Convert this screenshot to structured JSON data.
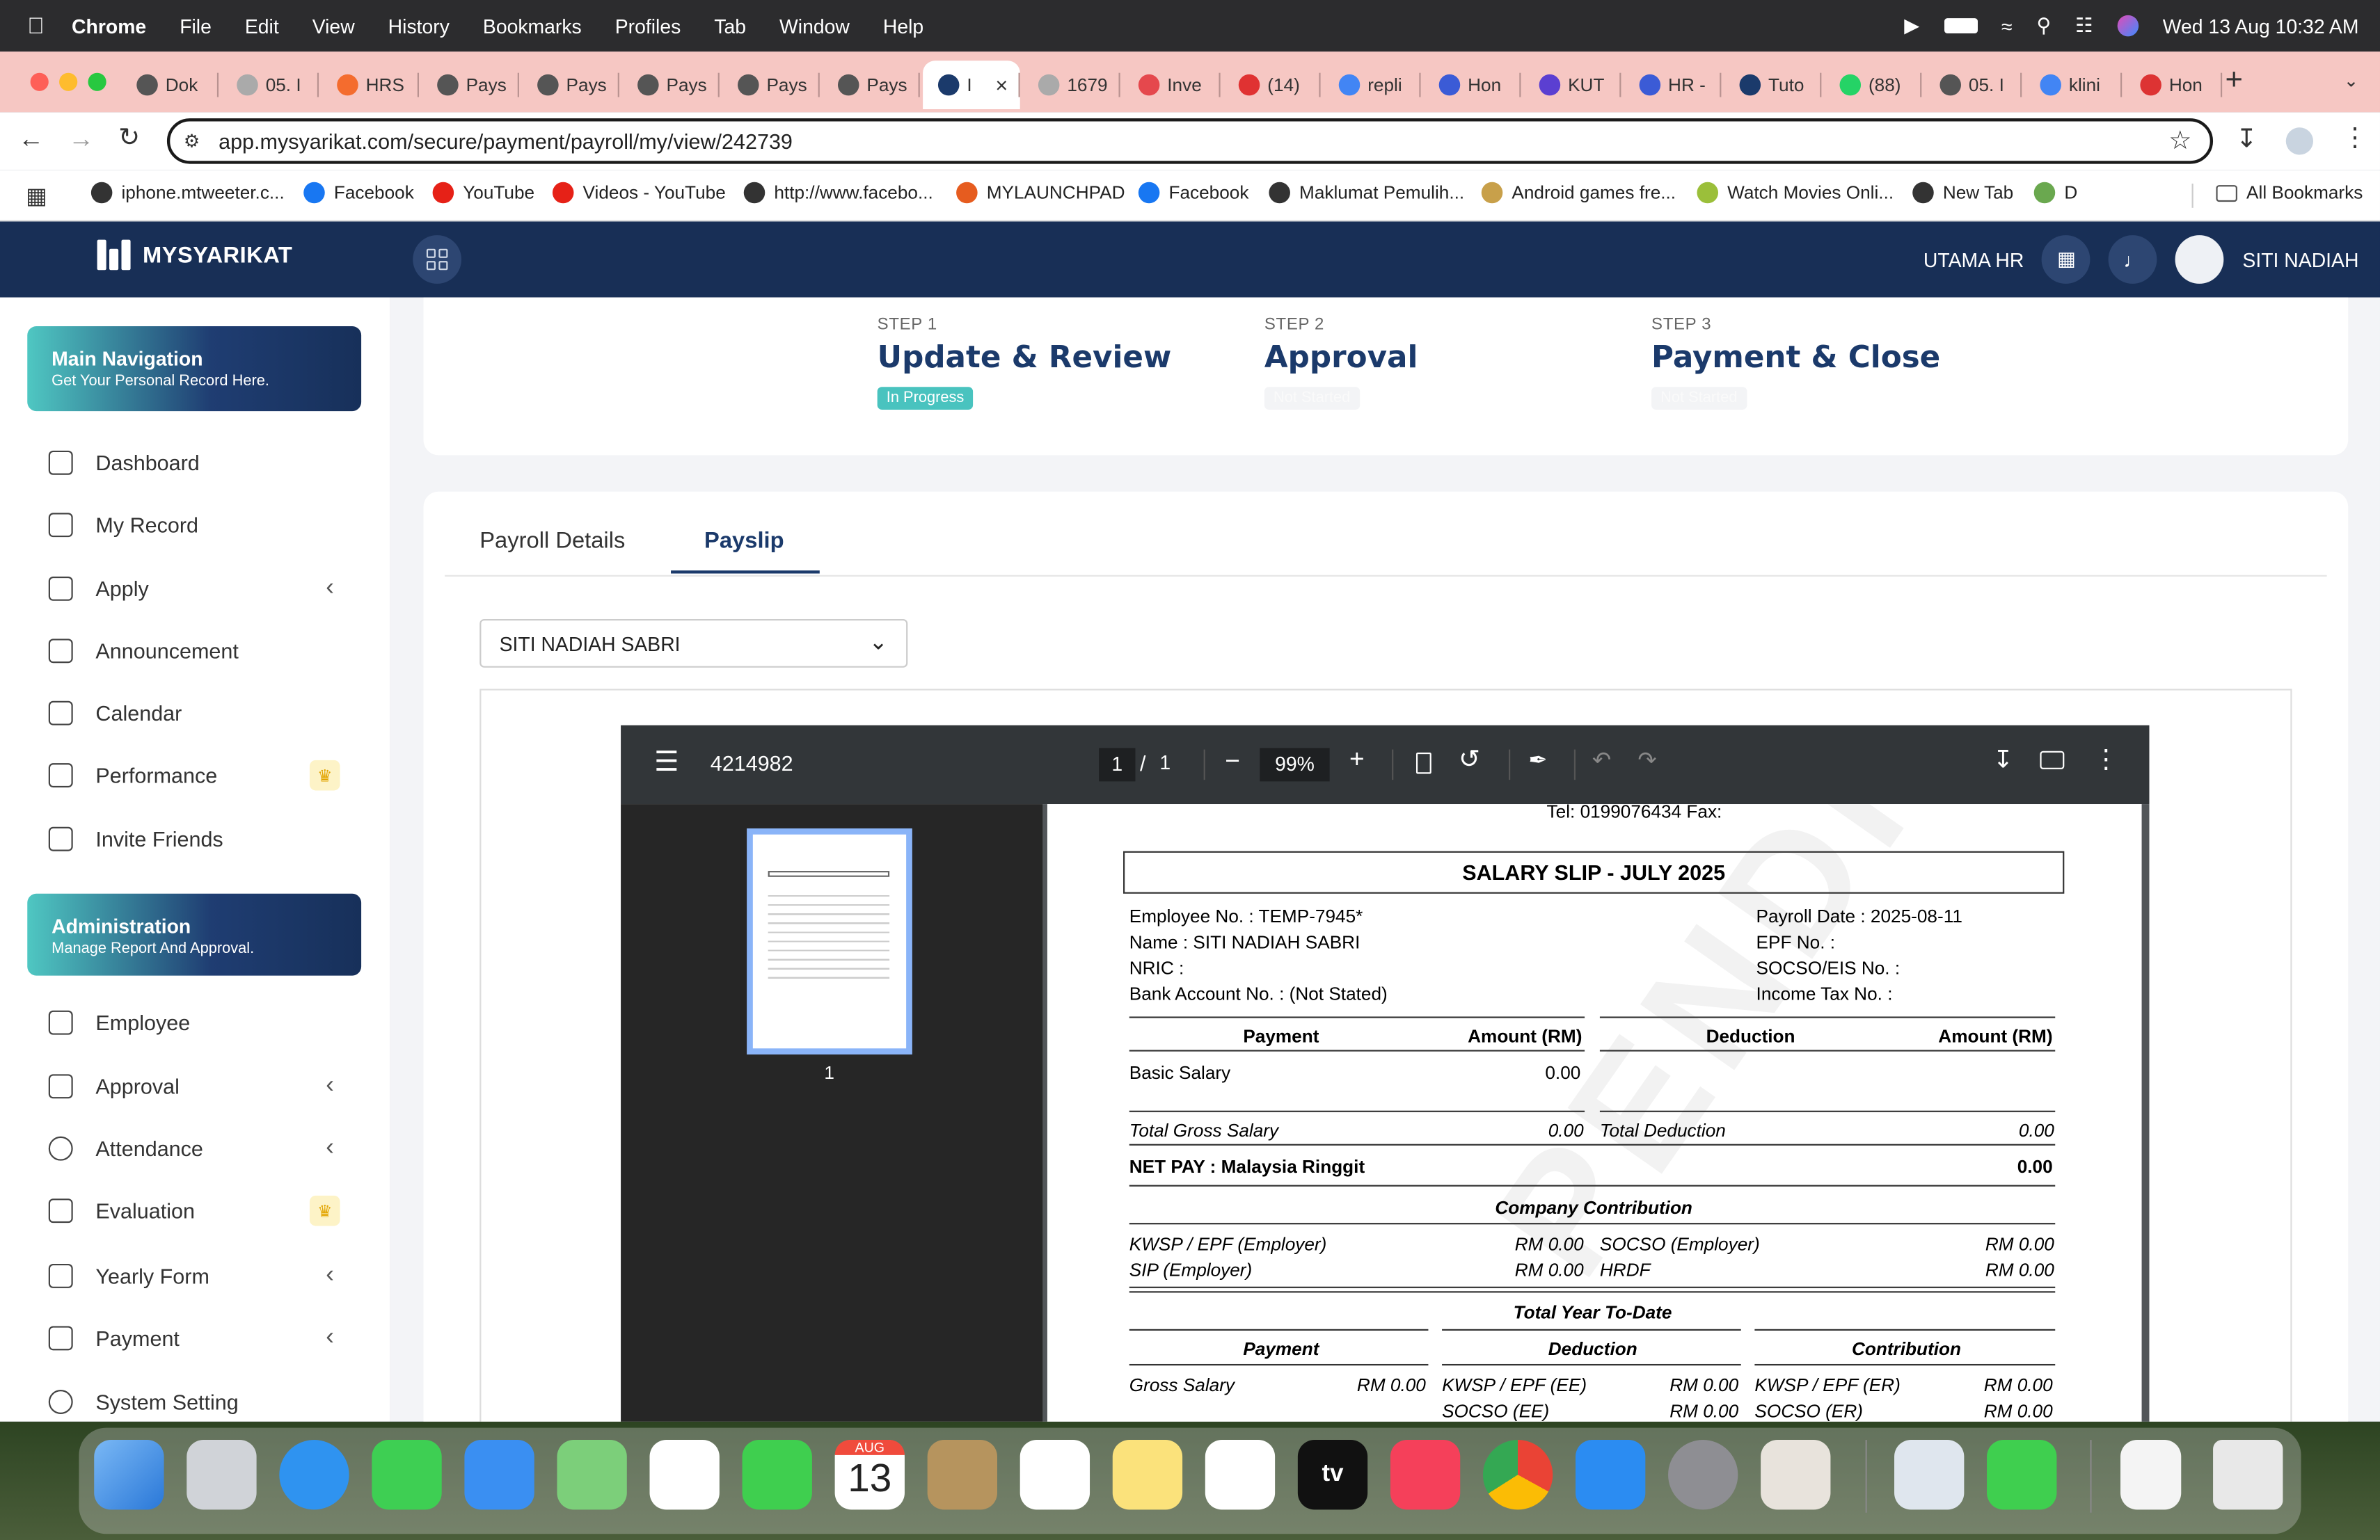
{
  "menubar": {
    "app": "Chrome",
    "items": [
      "File",
      "Edit",
      "View",
      "History",
      "Bookmarks",
      "Profiles",
      "Tab",
      "Window",
      "Help"
    ],
    "datetime": "Wed 13 Aug  10:32 AM"
  },
  "tabs": [
    {
      "label": "Dok"
    },
    {
      "label": "05. I"
    },
    {
      "label": "HRS"
    },
    {
      "label": "Pays"
    },
    {
      "label": "Pays"
    },
    {
      "label": "Pays"
    },
    {
      "label": "Pays"
    },
    {
      "label": "Pays"
    },
    {
      "label": "I",
      "active": true
    },
    {
      "label": "1679"
    },
    {
      "label": "Inve"
    },
    {
      "label": "(14)"
    },
    {
      "label": "repli"
    },
    {
      "label": "Hon"
    },
    {
      "label": "KUT"
    },
    {
      "label": "HR -"
    },
    {
      "label": "Tuto"
    },
    {
      "label": "(88)"
    },
    {
      "label": "05. I"
    },
    {
      "label": "klini"
    },
    {
      "label": "Hon"
    }
  ],
  "address": {
    "url": "app.mysyarikat.com/secure/payment/payroll/my/view/242739"
  },
  "bookmarks": [
    "iphone.mtweeter.c...",
    "Facebook",
    "YouTube",
    "Videos - YouTube",
    "http://www.facebo...",
    "MYLAUNCHPAD",
    "Facebook",
    "Maklumat Pemulih...",
    "Android games fre...",
    "Watch Movies Onli...",
    "New Tab",
    "D",
    "All Bookmarks"
  ],
  "header": {
    "brand": "MYSYARIKAT",
    "company": "UTAMA HR",
    "user": "SITI NADIAH"
  },
  "sidebar": {
    "main_nav": {
      "title": "Main Navigation",
      "subtitle": "Get Your Personal Record Here."
    },
    "items": [
      "Dashboard",
      "My Record",
      "Apply",
      "Announcement",
      "Calendar",
      "Performance",
      "Invite Friends"
    ],
    "admin": {
      "title": "Administration",
      "subtitle": "Manage Report And Approval."
    },
    "admin_items": [
      "Employee",
      "Approval",
      "Attendance",
      "Evaluation",
      "Yearly Form",
      "Payment",
      "System Setting"
    ]
  },
  "steps": [
    {
      "label": "STEP 1",
      "title": "Update & Review",
      "status": "In Progress"
    },
    {
      "label": "STEP 2",
      "title": "Approval",
      "status": "Not Started"
    },
    {
      "label": "STEP 3",
      "title": "Payment & Close",
      "status": "Not Started"
    }
  ],
  "page_tabs": {
    "details": "Payroll Details",
    "payslip": "Payslip"
  },
  "employee_select": "SITI NADIAH SABRI",
  "pdf": {
    "doc_id": "4214982",
    "page": "1",
    "pages": "1",
    "zoom": "99%",
    "thumb_label": "1"
  },
  "payslip": {
    "tel": "Tel: 0199076434 Fax:",
    "title": "SALARY SLIP - JULY 2025",
    "employee_no": "Employee No. : TEMP-7945*",
    "name": "Name : SITI NADIAH SABRI",
    "nric": "NRIC :",
    "bank": "Bank Account No. :  (Not Stated)",
    "payroll_date": "Payroll Date : 2025-08-11",
    "epf": "EPF No. :",
    "socso": "SOCSO/EIS No. :",
    "tax": "Income Tax No. :",
    "payment_h": "Payment",
    "amount_h": "Amount (RM)",
    "deduction_h": "Deduction",
    "amount_h2": "Amount (RM)",
    "basic_salary": "Basic Salary",
    "basic_salary_v": "0.00",
    "total_gross": "Total Gross Salary",
    "total_gross_v": "0.00",
    "total_deduction": "Total Deduction",
    "total_deduction_v": "0.00",
    "net_pay": "NET PAY :  Malaysia Ringgit",
    "net_pay_v": "0.00",
    "company_contribution": "Company Contribution",
    "kwsp_er": "KWSP / EPF (Employer)",
    "kwsp_er_v": "RM 0.00",
    "socso_er": "SOCSO (Employer)",
    "socso_er_v": "RM 0.00",
    "sip_er": "SIP (Employer)",
    "sip_er_v": "RM 0.00",
    "hrdf": "HRDF",
    "hrdf_v": "RM 0.00",
    "ytd": "Total Year To-Date",
    "ytd_payment": "Payment",
    "ytd_deduction": "Deduction",
    "ytd_contribution": "Contribution",
    "gross_salary": "Gross Salary",
    "gross_salary_v": "RM 0.00",
    "kwsp_ee": "KWSP / EPF (EE)",
    "kwsp_ee_v": "RM 0.00",
    "kwsp_er2": "KWSP / EPF (ER)",
    "kwsp_er2_v": "RM 0.00",
    "socso_ee": "SOCSO (EE)",
    "socso_ee_v": "RM 0.00",
    "socso_er2": "SOCSO (ER)",
    "socso_er2_v": "RM 0.00"
  }
}
